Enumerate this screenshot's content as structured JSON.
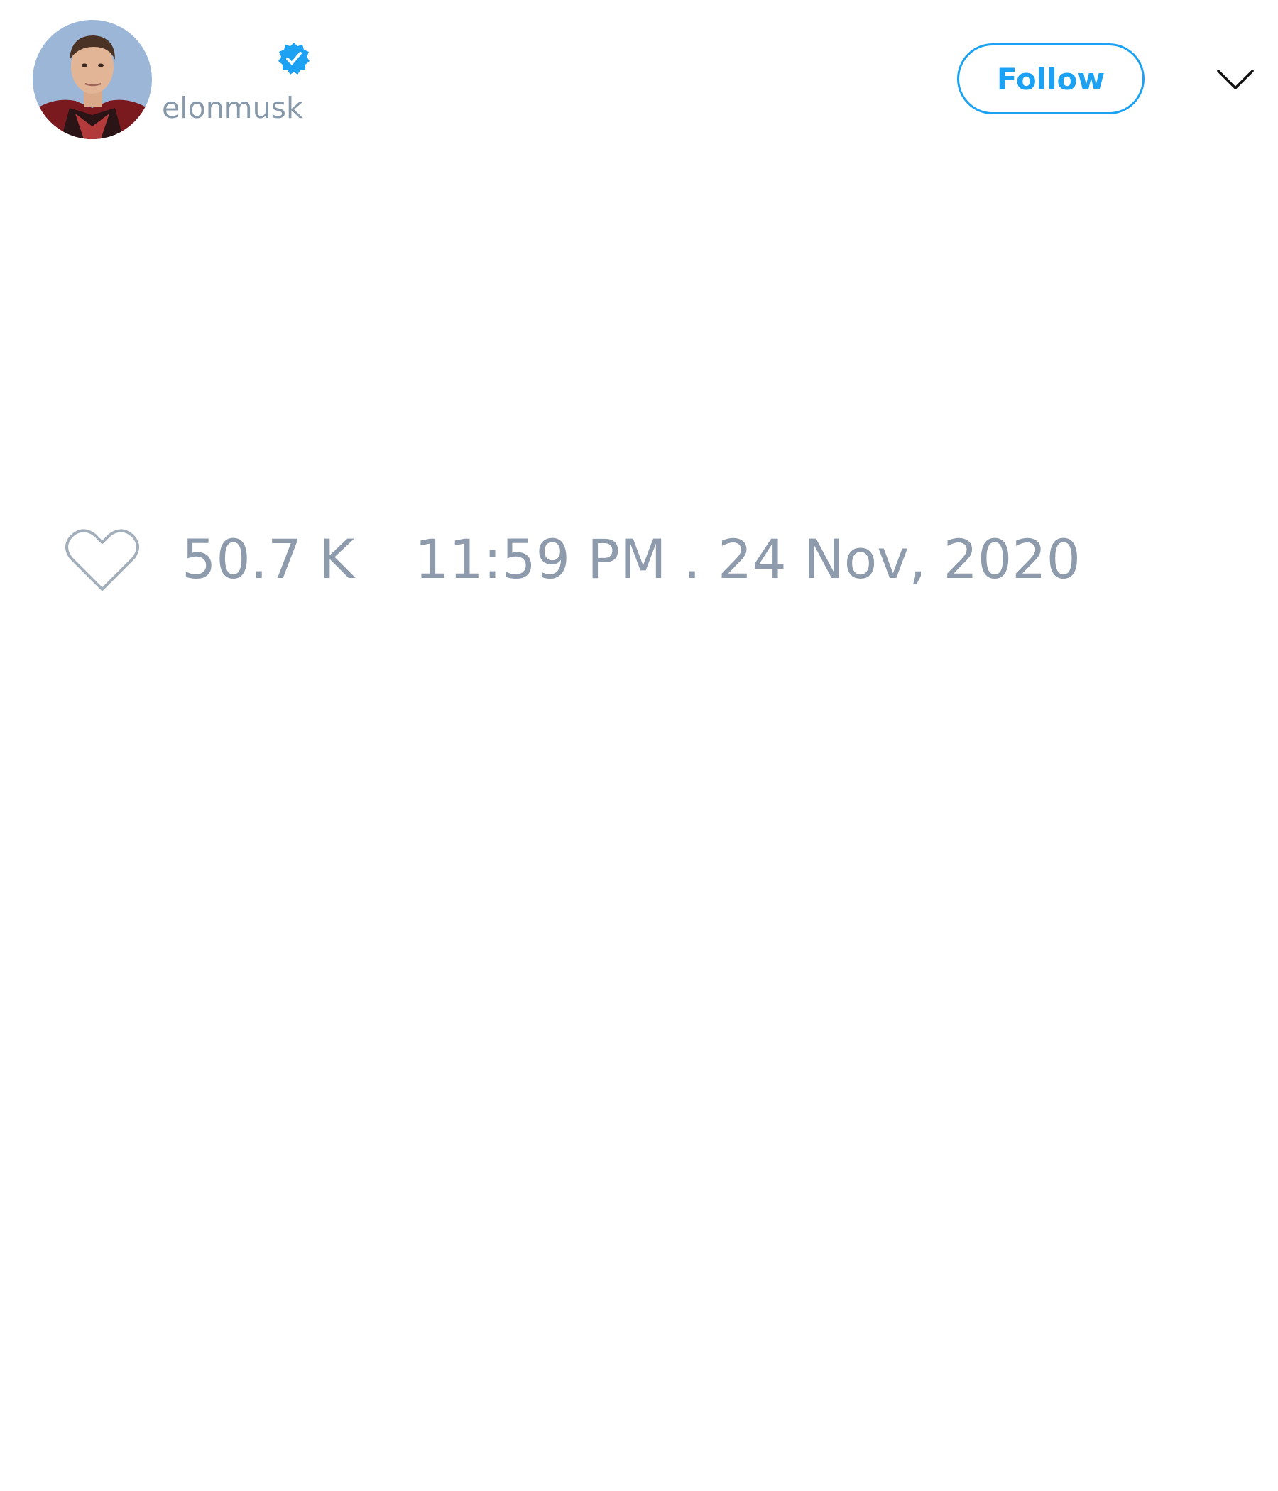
{
  "tweet": {
    "author": {
      "handle": "elonmusk",
      "verified": true,
      "avatar_icon": "profile-photo"
    },
    "follow_label": "Follow",
    "more_icon": "chevron-down-icon",
    "like_icon": "heart-outline-icon",
    "like_count": "50.7 K",
    "timestamp": "11:59 PM . 24 Nov, 2020"
  },
  "colors": {
    "accent": "#1da1f2",
    "muted_text": "#8e9bac",
    "background": "#ffffff"
  }
}
